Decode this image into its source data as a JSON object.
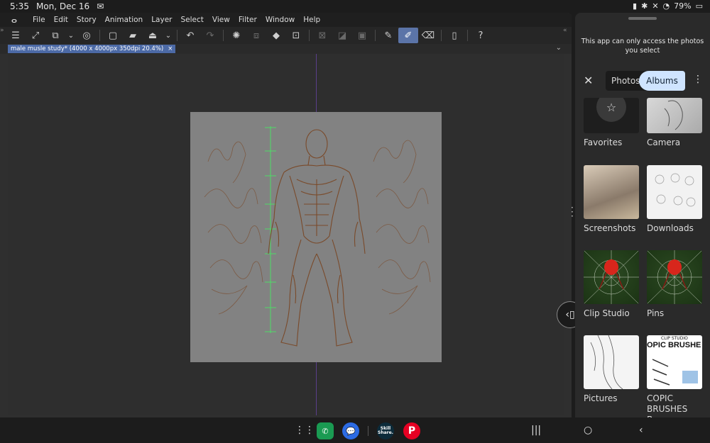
{
  "status": {
    "time": "5:35",
    "date": "Mon, Dec 16",
    "battery": "79%"
  },
  "menu": [
    "File",
    "Edit",
    "Story",
    "Animation",
    "Layer",
    "Select",
    "View",
    "Filter",
    "Window",
    "Help"
  ],
  "document_tab": {
    "title": "male musle study* (4000 x 4000px 350dpi 20.4%)",
    "close": "×"
  },
  "picker": {
    "message": "This app can only access the photos you select",
    "tab_photos": "Photos",
    "tab_albums": "Albums",
    "albums": [
      {
        "label": "Favorites"
      },
      {
        "label": "Camera"
      },
      {
        "label": "Screenshots"
      },
      {
        "label": "Downloads"
      },
      {
        "label": "Clip Studio"
      },
      {
        "label": "Pins"
      },
      {
        "label": "Pictures"
      },
      {
        "label": "COPIC BRUSHES B..."
      }
    ],
    "thumb_text": {
      "copic_header": "CLIP STUDIO",
      "copic_title": "OPIC BRUSHE"
    }
  },
  "dock": {
    "apps": [
      "phone-app",
      "messages-app",
      "skillshare-app",
      "pinterest-app"
    ],
    "skillshare_text": "Skill Share."
  },
  "colors": {
    "accent": "#5b74a8",
    "tab_active": "#cfe4ff",
    "sketch": "#7a4a2a",
    "ruler": "#4ddc66"
  }
}
